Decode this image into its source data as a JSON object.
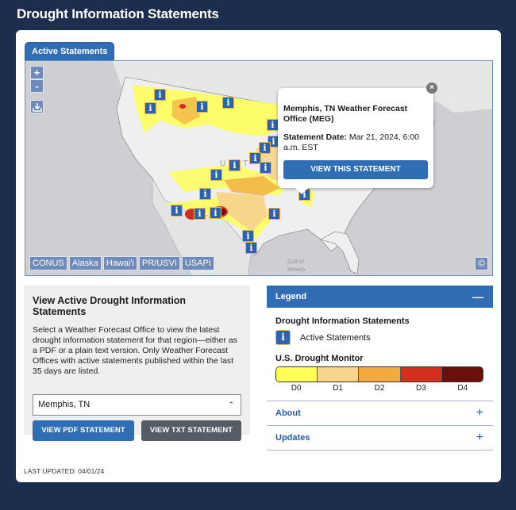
{
  "page": {
    "title": "Drought Information Statements"
  },
  "map": {
    "tab_label": "Active Statements",
    "zoom_in": "+",
    "zoom_out": "-",
    "download_icon": "download-icon",
    "regions": [
      "CONUS",
      "Alaska",
      "Hawai'i",
      "PR/USVI",
      "USAPI"
    ],
    "copyright_symbol": "©",
    "marker_glyph": "i",
    "labels": {
      "country": "UNIT",
      "gulf": "Gulf of Mexico",
      "mexico": "México"
    },
    "popup": {
      "title": "Memphis, TN Weather Forecast Office (MEG)",
      "date_label": "Statement Date:",
      "date_value": "Mar 21, 2024, 6:00 a.m. EST",
      "button": "VIEW THIS STATEMENT",
      "close": "×"
    }
  },
  "left_panel": {
    "title": "View Active Drought Information Statements",
    "description": "Select a Weather Forecast Office to view the latest drought information statement for that region—either as a PDF or a plain text version. Only Weather Forecast Offices with active statements published within the last 35 days are listed.",
    "select_value": "Memphis, TN",
    "pdf_button": "VIEW PDF STATEMENT",
    "txt_button": "VIEW TXT STATEMENT"
  },
  "legend": {
    "header": "Legend",
    "collapse_symbol": "—",
    "dis_title": "Drought Information Statements",
    "active_label": "Active Statements",
    "usdm_title": "U.S. Drought Monitor",
    "categories": [
      {
        "label": "D0",
        "color": "#ffff54"
      },
      {
        "label": "D1",
        "color": "#f7d58b"
      },
      {
        "label": "D2",
        "color": "#f1ab3e"
      },
      {
        "label": "D3",
        "color": "#d42e1f"
      },
      {
        "label": "D4",
        "color": "#6b0f0c"
      }
    ],
    "accordions": [
      {
        "label": "About",
        "symbol": "+"
      },
      {
        "label": "Updates",
        "symbol": "+"
      }
    ]
  },
  "footer": {
    "last_updated": "LAST UPDATED: 04/01/24"
  }
}
